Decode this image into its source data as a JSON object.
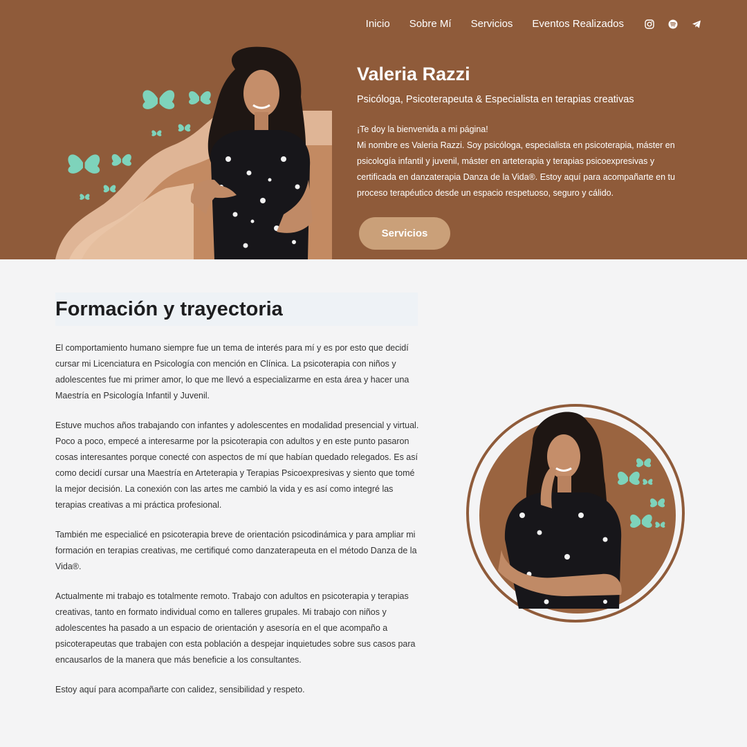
{
  "nav": {
    "items": [
      {
        "label": "Inicio"
      },
      {
        "label": "Sobre Mí"
      },
      {
        "label": "Servicios"
      },
      {
        "label": "Eventos Realizados"
      }
    ],
    "social": [
      "instagram-icon",
      "spotify-icon",
      "telegram-icon"
    ]
  },
  "hero": {
    "name": "Valeria Razzi",
    "subtitle": "Psicóloga, Psicoterapeuta & Especialista en terapias creativas",
    "welcome": "¡Te doy la bienvenida a mi página!",
    "bio": "Mi nombre es Valeria Razzi. Soy psicóloga, especialista en psicoterapia, máster en psicología infantil y juvenil, máster en arteterapia y terapias psicoexpresivas y certificada en danzaterapia Danza de la Vida®. Estoy aquí para acompañarte en tu proceso terapéutico desde un espacio respetuoso, seguro y cálido.",
    "button_label": "Servicios"
  },
  "section": {
    "title": "Formación y trayectoria",
    "paragraphs": [
      "El comportamiento humano siempre fue un tema de interés para mí y es por esto que decidí cursar mi Licenciatura en Psicología con mención en Clínica. La psicoterapia con niños y adolescentes fue mi primer amor, lo que me llevó a especializarme en esta área y hacer una Maestría en Psicología Infantil y Juvenil.",
      "Estuve muchos años trabajando con infantes y adolescentes en modalidad presencial y virtual. Poco a poco, empecé a interesarme por la psicoterapia con adultos y en este punto pasaron cosas interesantes porque conecté con aspectos de mí que habían quedado relegados. Es así como decidí cursar una Maestría en Arteterapia y Terapias Psicoexpresivas y siento que tomé la mejor decisión. La conexión con las artes me cambió la vida y es así como integré las terapias creativas a mi práctica profesional.",
      "También me especialicé en psicoterapia breve de orientación psicodinámica y para ampliar mi formación en terapias creativas, me certifiqué como danzaterapeuta en el método Danza de la Vida®.",
      "Actualmente mi trabajo es totalmente remoto. Trabajo con adultos en psicoterapia y terapias creativas, tanto en formato individual como en talleres grupales. Mi trabajo con niños y adolescentes ha pasado a un espacio de orientación y asesoría en el que acompaño a psicoterapeutas que trabajen con esta población a despejar inquietudes sobre sus casos para encausarlos de la manera que más beneficie a los consultantes.",
      "Estoy aquí para acompañarte con calidez, sensibilidad y respeto."
    ]
  },
  "colors": {
    "brand_brown": "#8f5b3a",
    "button_tan": "#caa079",
    "butterfly_mint": "#7ed3bb",
    "page_bg": "#f4f4f5"
  }
}
